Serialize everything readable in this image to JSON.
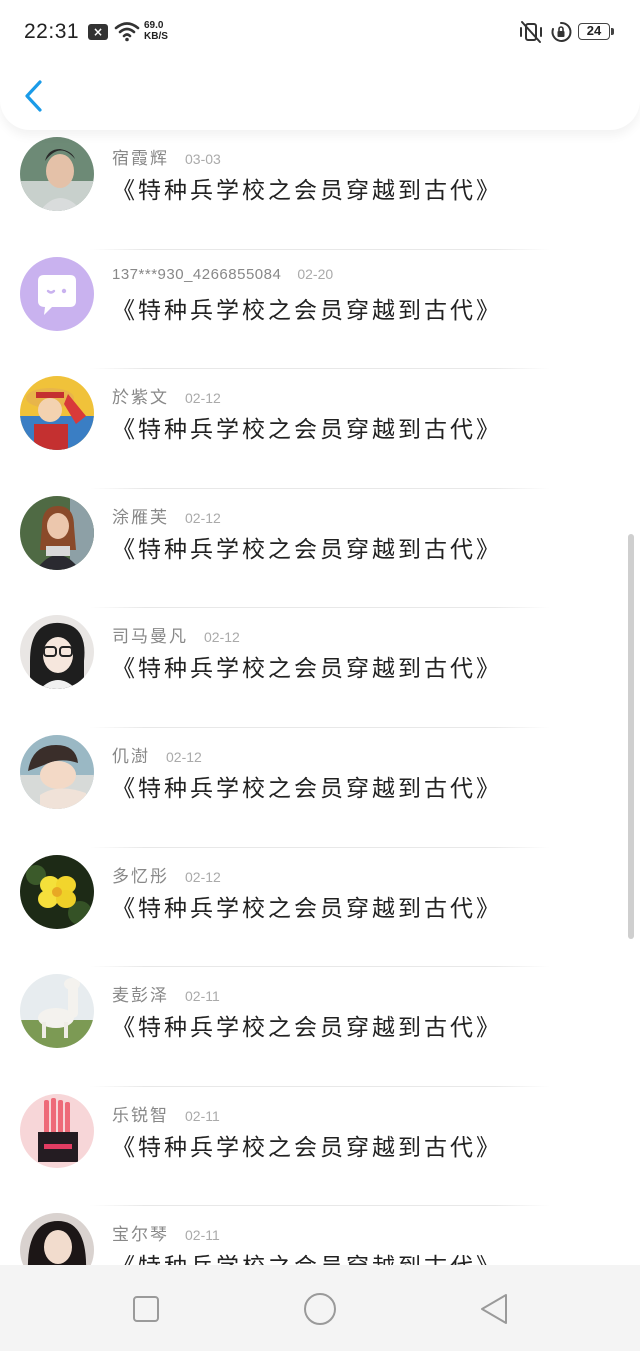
{
  "status_bar": {
    "time": "22:31",
    "notification_badge": "×",
    "speed_value": "69.0",
    "speed_unit": "KB/S",
    "battery": "24"
  },
  "header": {
    "back_icon": "chevron-left-icon",
    "accent_color": "#1a9be8"
  },
  "title_text": "《特种兵学校之会员穿越到古代》",
  "items": [
    {
      "name": "宿霞辉",
      "date": "03-03",
      "title": "《特种兵学校之会员穿越到古代》",
      "avatar": "photo-man"
    },
    {
      "name": "137***930_4266855084",
      "date": "02-20",
      "title": "《特种兵学校之会员穿越到古代》",
      "avatar": "chat-bubble-default"
    },
    {
      "name": "於紫文",
      "date": "02-12",
      "title": "《特种兵学校之会员穿越到古代》",
      "avatar": "cartoon-pirate"
    },
    {
      "name": "涂雁芙",
      "date": "02-12",
      "title": "《特种兵学校之会员穿越到古代》",
      "avatar": "photo-woman-scarf"
    },
    {
      "name": "司马曼凡",
      "date": "02-12",
      "title": "《特种兵学校之会员穿越到古代》",
      "avatar": "photo-girl-glasses"
    },
    {
      "name": "仉澍",
      "date": "02-12",
      "title": "《特种兵学校之会员穿越到古代》",
      "avatar": "photo-girl"
    },
    {
      "name": "多忆彤",
      "date": "02-12",
      "title": "《特种兵学校之会员穿越到古代》",
      "avatar": "photo-yellow-flower"
    },
    {
      "name": "麦彭泽",
      "date": "02-11",
      "title": "《特种兵学校之会员穿越到古代》",
      "avatar": "photo-alpaca"
    },
    {
      "name": "乐锐智",
      "date": "02-11",
      "title": "《特种兵学校之会员穿越到古代》",
      "avatar": "photo-pink-box"
    },
    {
      "name": "宝尔琴",
      "date": "02-11",
      "title": "《特种兵学校之会员穿越到古代》",
      "avatar": "photo-girl-dark"
    }
  ],
  "nav_bar": {
    "recents_icon": "square-icon",
    "home_icon": "circle-icon",
    "back_icon": "triangle-back-icon"
  }
}
